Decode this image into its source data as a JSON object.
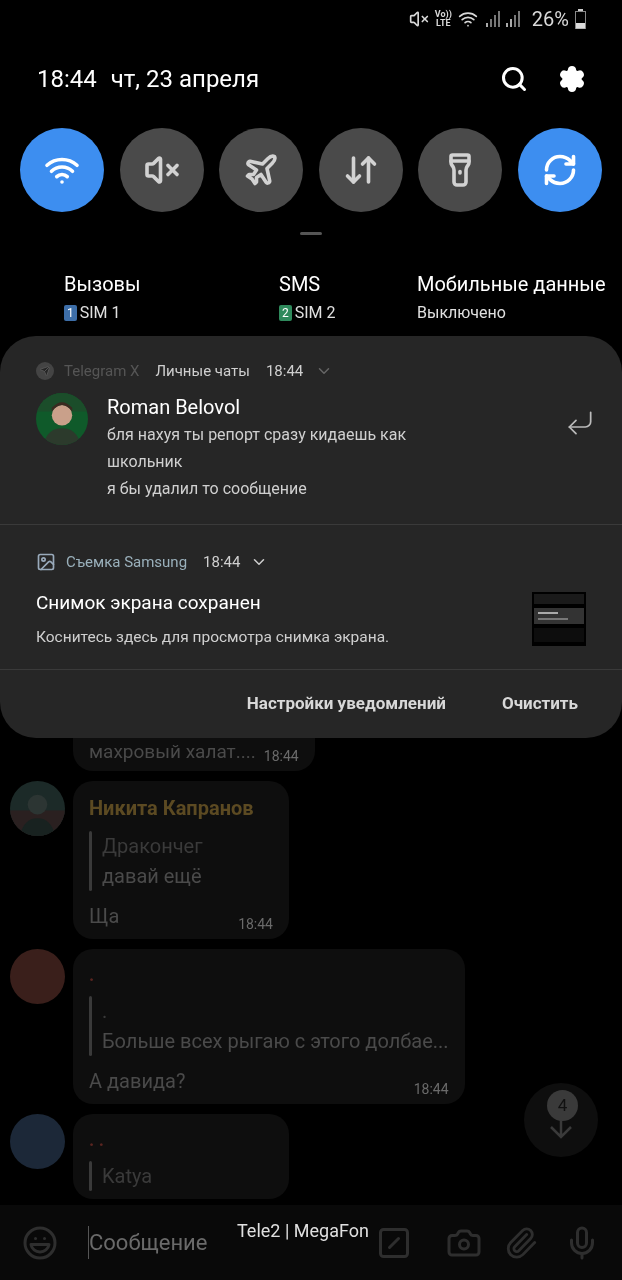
{
  "status_bar": {
    "volte": "Vo))",
    "lte": "LTE",
    "battery": "26%"
  },
  "header": {
    "time": "18:44",
    "date": "чт, 23 апреля"
  },
  "toggles": [
    {
      "kind": "wifi",
      "on": true
    },
    {
      "kind": "mute",
      "on": false
    },
    {
      "kind": "airplane",
      "on": false
    },
    {
      "kind": "data",
      "on": false
    },
    {
      "kind": "flashlight",
      "on": false
    },
    {
      "kind": "rotate",
      "on": true
    }
  ],
  "sim_settings": [
    {
      "title": "Вызовы",
      "badge": "1",
      "label": "SIM 1",
      "color": "#3d6ea8"
    },
    {
      "title": "SMS",
      "badge": "2",
      "label": "SIM 2",
      "color": "#2f8a5c"
    },
    {
      "title": "Мобильные данные",
      "label": "Выключено"
    }
  ],
  "notifications": [
    {
      "kind": "message",
      "app": "Telegram X",
      "channel": "Личные чаты",
      "time": "18:44",
      "sender": "Roman Belovol",
      "lines": [
        "бля нахуя ты репорт сразу кидаешь как школьник",
        "я бы удалил то сообщение"
      ]
    },
    {
      "kind": "screenshot",
      "app": "Съемка Samsung",
      "time": "18:44",
      "title": "Снимок экрана сохранен",
      "body": "Коснитесь здесь для просмотра снимка экрана."
    }
  ],
  "actions": [
    "Настройки уведомлений",
    "Очистить"
  ],
  "chat": [
    {
      "kind": "tail",
      "text": "махровый халат....",
      "time": "18:44"
    },
    {
      "sender": "Никита Капранов",
      "reply_author": "Дракончег",
      "reply_text": "давай ещё",
      "text": "Ща",
      "time": "18:44"
    },
    {
      "kind": "plain",
      "color": "#3a1f1b",
      "sender": ".",
      "reply_author": ".",
      "reply_text": "Больше всех рыгаю с этого долбае...",
      "text": "А давида?",
      "time": "18:44"
    },
    {
      "kind": "plain",
      "color": "#1c2838",
      "sender": ". .",
      "reply_author": "Katya"
    }
  ],
  "scroll_badge": "4",
  "composer": {
    "placeholder": "Сообщение"
  },
  "carrier": "Tele2 | MegaFon"
}
